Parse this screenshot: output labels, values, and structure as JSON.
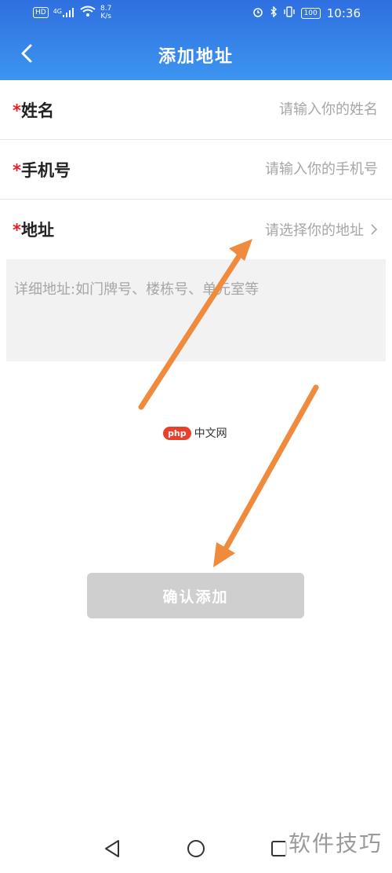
{
  "status_bar": {
    "network_badge": "HD",
    "signal_type": "4G",
    "speed_value": "8.7",
    "speed_unit": "K/s",
    "battery": "100",
    "time": "10:36"
  },
  "header": {
    "title": "添加地址"
  },
  "form": {
    "name": {
      "required_mark": "*",
      "label": "姓名",
      "placeholder": "请输入你的姓名"
    },
    "phone": {
      "required_mark": "*",
      "label": "手机号",
      "placeholder": "请输入你的手机号"
    },
    "address": {
      "required_mark": "*",
      "label": "地址",
      "select_text": "请选择你的地址"
    },
    "detail": {
      "placeholder": "详细地址:如门牌号、楼栋号、单元室等"
    }
  },
  "confirm_button": {
    "label": "确认添加"
  },
  "watermarks": {
    "center_logo": "php",
    "center_text": "中文网",
    "bottom_right": "软件技巧"
  },
  "colors": {
    "header_gradient_top": "#2f6fe0",
    "header_gradient_bottom": "#3d95f0",
    "required_star": "#d9232a",
    "placeholder": "#a6a6a6",
    "detail_background": "#f2f2f2",
    "button_disabled": "#cfcfcf",
    "annotation_arrow": "#f08a3c"
  }
}
